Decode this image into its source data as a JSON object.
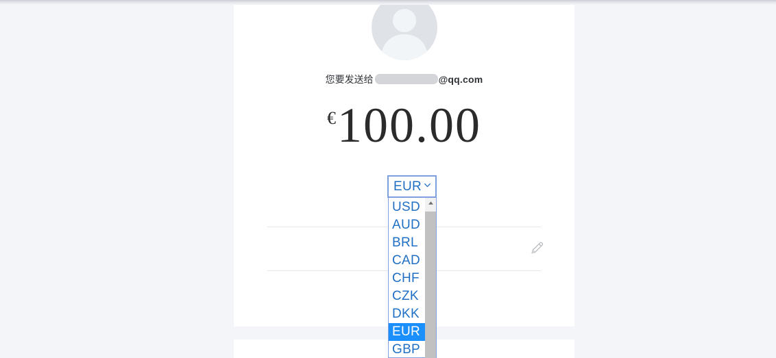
{
  "page": {
    "background_color": "#f4f5f9",
    "card_background": "#ffffff"
  },
  "avatar": {
    "icon": "user-avatar-placeholder-icon",
    "circle_color": "#dfe3e8",
    "silhouette_color": "#f2f5f8"
  },
  "recipient": {
    "prefix_label": "您要发送给",
    "redacted_value": "",
    "domain_label": "@qq.com"
  },
  "amount": {
    "currency_symbol": "€",
    "value": "100.00"
  },
  "currency_select": {
    "name": "currency-select",
    "selected_value": "EUR",
    "chevron_icon": "chevron-down-icon",
    "border_color": "#7d9fdd",
    "text_color": "#1f6fc4",
    "expanded": true,
    "highlight_color": "#1b8ffb",
    "options": [
      {
        "code": "USD",
        "selected": false
      },
      {
        "code": "AUD",
        "selected": false
      },
      {
        "code": "BRL",
        "selected": false
      },
      {
        "code": "CAD",
        "selected": false
      },
      {
        "code": "CHF",
        "selected": false
      },
      {
        "code": "CZK",
        "selected": false
      },
      {
        "code": "DKK",
        "selected": false
      },
      {
        "code": "EUR",
        "selected": true
      },
      {
        "code": "GBP",
        "selected": false
      }
    ],
    "scrollbar": {
      "arrow_up_icon": "scroll-up-arrow-icon",
      "track_color": "#f1f1f1",
      "thumb_color": "#c1c1c1"
    }
  },
  "note_rows": {
    "edit_icon": "pencil-edit-icon",
    "divider_color": "#e6e8eb",
    "row_value": ""
  }
}
